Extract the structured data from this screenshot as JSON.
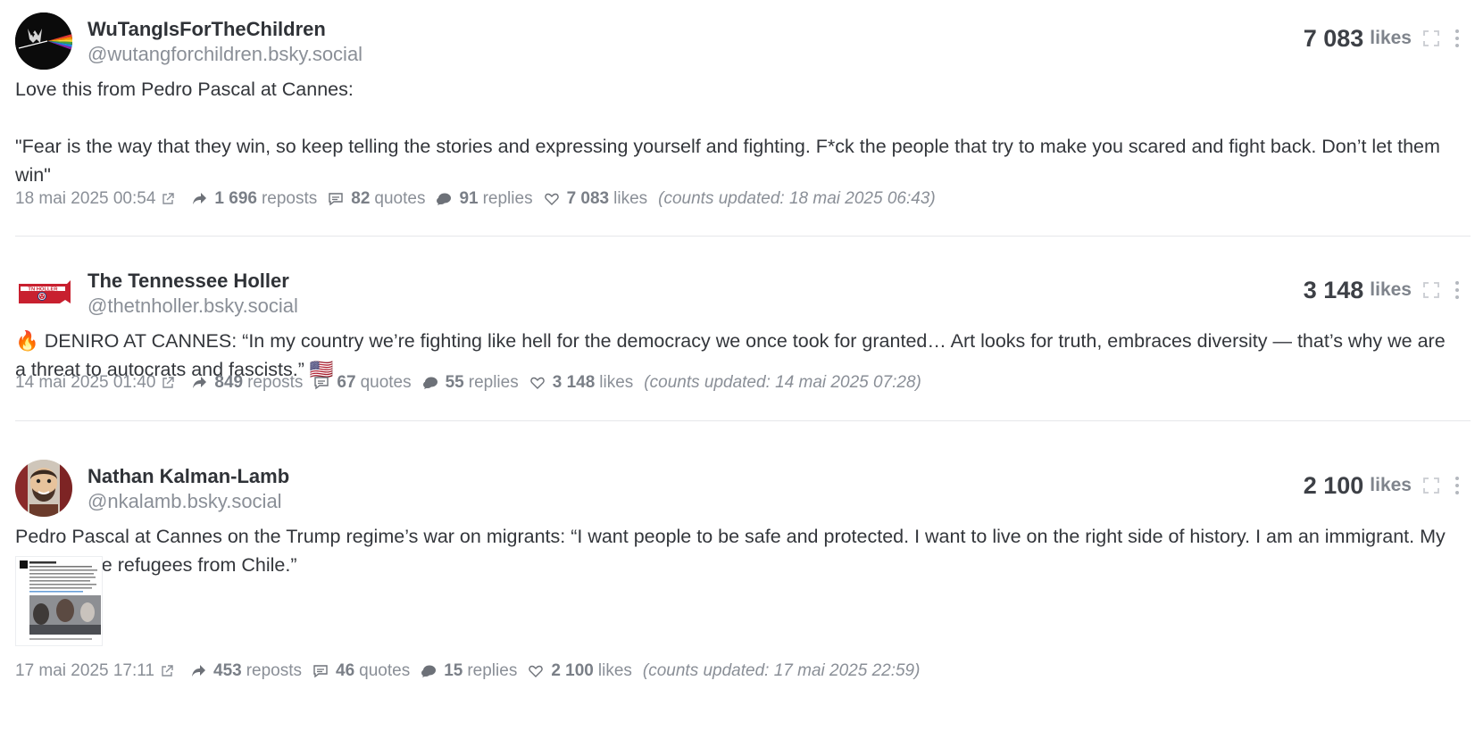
{
  "posts": [
    {
      "author_name": "WuTangIsForTheChildren",
      "handle": "@wutangforchildren.bsky.social",
      "likes_count": "7 083",
      "likes_word": "likes",
      "text_lines": [
        "Love this from Pedro Pascal at Cannes:",
        "\"Fear is the way that they win, so keep telling the stories and expressing yourself and fighting. F*ck the people that try to make you scared and fight back. Don’t let them win\""
      ],
      "date": "18 mai 2025 00:54",
      "reposts": "1 696",
      "reposts_label": "reposts",
      "quotes": "82",
      "quotes_label": "quotes",
      "replies": "91",
      "replies_label": "replies",
      "likes": "7 083",
      "likes_label": "likes",
      "updated_prefix": "(counts updated: ",
      "updated_value": "18 mai 2025 06:43",
      "updated_suffix": ")"
    },
    {
      "author_name": "The Tennessee Holler",
      "handle": "@thetnholler.bsky.social",
      "avatar_text": "TN HOLLER",
      "likes_count": "3 148",
      "likes_word": "likes",
      "text_lines": [
        "🔥 DENIRO AT CANNES: “In my country we’re fighting like hell for the democracy we once took for granted… Art looks for truth, embraces diversity — that’s why we are a threat to autocrats and fascists.” 🇺🇸"
      ],
      "date": "14 mai 2025 01:40",
      "reposts": "849",
      "reposts_label": "reposts",
      "quotes": "67",
      "quotes_label": "quotes",
      "replies": "55",
      "replies_label": "replies",
      "likes": "3 148",
      "likes_label": "likes",
      "updated_prefix": "(counts updated: ",
      "updated_value": "14 mai 2025 07:28",
      "updated_suffix": ")"
    },
    {
      "author_name": "Nathan Kalman-Lamb",
      "handle": "@nkalamb.bsky.social",
      "likes_count": "2 100",
      "likes_word": "likes",
      "text_lines": [
        "Pedro Pascal at Cannes on the Trump regime’s war on migrants: “I want people to be safe and protected. I want to live on the right side of history. I am an immigrant. My parents are refugees from Chile.”"
      ],
      "date": "17 mai 2025 17:11",
      "reposts": "453",
      "reposts_label": "reposts",
      "quotes": "46",
      "quotes_label": "quotes",
      "replies": "15",
      "replies_label": "replies",
      "likes": "2 100",
      "likes_label": "likes",
      "updated_prefix": "(counts updated: ",
      "updated_value": "17 mai 2025 22:59",
      "updated_suffix": ")"
    }
  ],
  "colors": {
    "text": "#33363b",
    "muted": "#8a8f97",
    "divider": "#e6e7ea",
    "holler_red": "#c8202f",
    "holler_blue": "#1f3a7a"
  }
}
